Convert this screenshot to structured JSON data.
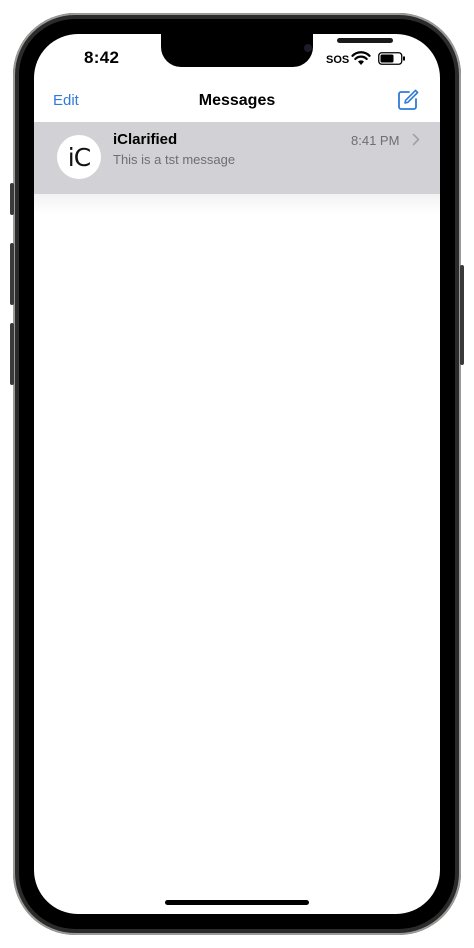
{
  "status_bar": {
    "time": "8:42",
    "sos": "SOS"
  },
  "navbar": {
    "edit_label": "Edit",
    "title": "Messages",
    "compose_icon": "compose-icon"
  },
  "conversations": [
    {
      "avatar_text": "iC",
      "name": "iClarified",
      "preview": "This is a tst message",
      "timestamp": "8:41 PM"
    }
  ],
  "colors": {
    "accent": "#2f7bd8",
    "selected_row": "#d1d1d6",
    "secondary_text": "#6e6e73"
  }
}
